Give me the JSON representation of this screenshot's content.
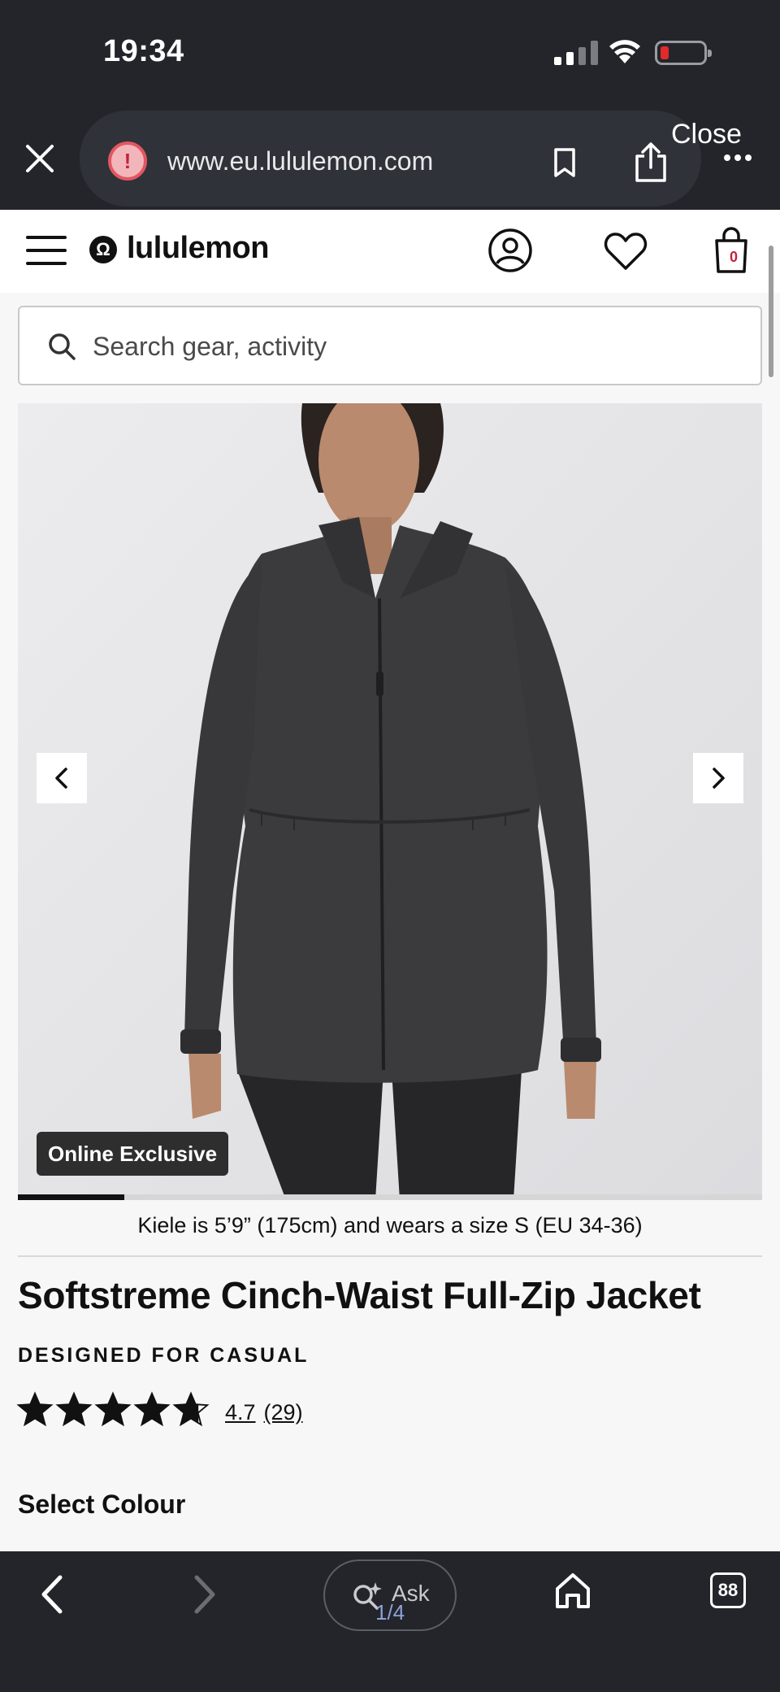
{
  "status_bar": {
    "time": "19:34"
  },
  "browser": {
    "url": "www.eu.lululemon.com",
    "close_label": "Close"
  },
  "site_header": {
    "logo_text": "lululemon",
    "bag_count": "0"
  },
  "search": {
    "placeholder": "Search gear, activity"
  },
  "gallery": {
    "badge": "Online Exclusive",
    "current_image": 1,
    "total_images": 4
  },
  "product": {
    "model_info": "Kiele is 5’9” (175cm) and wears a size S (EU 34-36)",
    "title": "Softstreme Cinch-Waist Full-Zip Jacket",
    "designed_for": "DESIGNED FOR CASUAL",
    "rating": "4.7",
    "review_count": "(29)",
    "star_rating": 4.7,
    "select_colour_label": "Select Colour"
  },
  "bottom_bar": {
    "ask_label": "Ask",
    "page_indicator": "1/4",
    "tabs_count": "88"
  },
  "colors": {
    "chrome_dark": "#23252b",
    "warning_red": "#e15763",
    "jacket": "#3b3b3d",
    "page_bg": "#f7f7f7"
  }
}
